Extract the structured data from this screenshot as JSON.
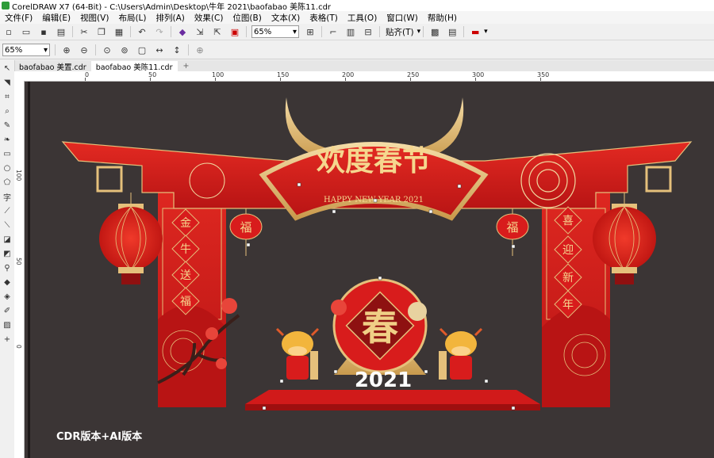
{
  "window": {
    "title": "CorelDRAW X7 (64-Bit) - C:\\Users\\Admin\\Desktop\\牛年 2021\\baofabao 美陈11.cdr"
  },
  "menu": [
    {
      "label": "文件(F)"
    },
    {
      "label": "编辑(E)"
    },
    {
      "label": "视图(V)"
    },
    {
      "label": "布局(L)"
    },
    {
      "label": "排列(A)"
    },
    {
      "label": "效果(C)"
    },
    {
      "label": "位图(B)"
    },
    {
      "label": "文本(X)"
    },
    {
      "label": "表格(T)"
    },
    {
      "label": "工具(O)"
    },
    {
      "label": "窗口(W)"
    },
    {
      "label": "帮助(H)"
    }
  ],
  "toolbar": {
    "zoom_value": "65%",
    "snap_label": "贴齐(T)"
  },
  "propbar": {
    "zoom_value": "65%"
  },
  "tabs": [
    {
      "label": "baofabao 美置.cdr"
    },
    {
      "label": "baofabao 美陈11.cdr"
    }
  ],
  "ruler_h_labels": [
    "0",
    "50",
    "100",
    "150",
    "200",
    "250",
    "300",
    "350"
  ],
  "ruler_v_labels": [
    "100",
    "50",
    "0"
  ],
  "artwork": {
    "headline": "欢度春节",
    "subtitle": "HAPPY NEW YEAR 2021",
    "left_couplet": [
      "金",
      "牛",
      "送",
      "福"
    ],
    "right_couplet": [
      "喜",
      "迎",
      "新",
      "年"
    ],
    "fu": "福",
    "chun": "春",
    "year": "2021"
  },
  "watermark": "CDR版本+AI版本",
  "colors": {
    "canvas_bg": "#3b3535",
    "red": "#d81c1c",
    "dark_red": "#9e1010",
    "gold": "#e5c07b"
  }
}
